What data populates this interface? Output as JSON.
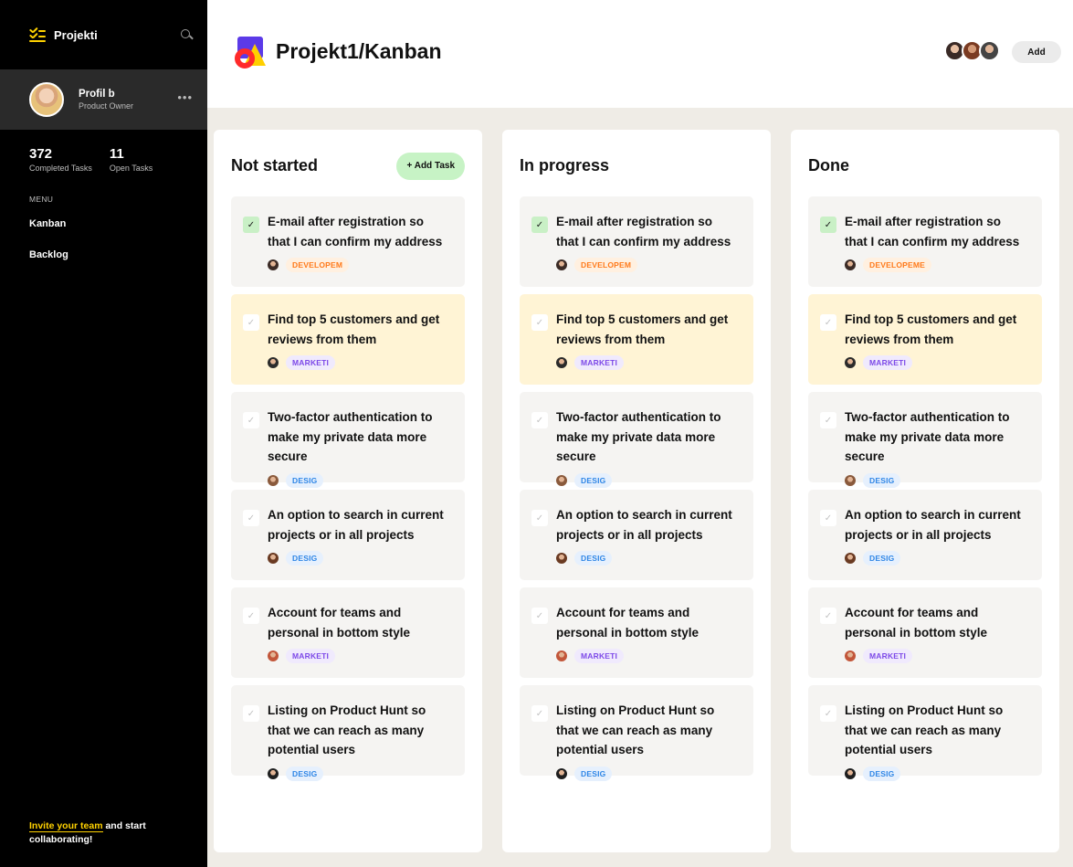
{
  "sidebar": {
    "brand": "Projekti",
    "profile": {
      "name": "Profil b",
      "role": "Product Owner"
    },
    "stats": [
      {
        "value": "372",
        "label": "Completed Tasks"
      },
      {
        "value": "11",
        "label": "Open Tasks"
      }
    ],
    "menu_title": "MENU",
    "menu": [
      {
        "label": "Kanban"
      },
      {
        "label": "Backlog"
      }
    ],
    "invite_link": "Invite your team",
    "invite_rest": " and start collaborating!"
  },
  "header": {
    "title": "Projekt1/Kanban",
    "add_label": "Add"
  },
  "add_task_label": "+ Add Task",
  "columns": [
    {
      "title": "Not started",
      "cards": [
        {
          "title": "E-mail after registration so that I can confirm my address",
          "tag": "DEVELOPEM",
          "tag_type": "dev",
          "checked": true,
          "highlight": false
        },
        {
          "title": "Find top 5 customers and get reviews from them",
          "tag": "MARKETI",
          "tag_type": "mkt",
          "checked": false,
          "highlight": true
        },
        {
          "title": "Two-factor authentication to make my private data more secure",
          "tag": "DESIG",
          "tag_type": "des",
          "checked": false,
          "highlight": false
        },
        {
          "title": "An option to search in current projects or in all projects",
          "tag": "DESIG",
          "tag_type": "des",
          "checked": false,
          "highlight": false
        },
        {
          "title": "Account for teams and personal in bottom style",
          "tag": "MARKETI",
          "tag_type": "mkt",
          "checked": false,
          "highlight": false
        },
        {
          "title": "Listing on Product Hunt so that we can reach as many potential users",
          "tag": "DESIG",
          "tag_type": "des",
          "checked": false,
          "highlight": false
        }
      ]
    },
    {
      "title": "In progress",
      "cards": [
        {
          "title": "E-mail after registration so that I can confirm my address",
          "tag": "DEVELOPEM",
          "tag_type": "dev",
          "checked": true,
          "highlight": false
        },
        {
          "title": "Find top 5 customers and get reviews from them",
          "tag": "MARKETI",
          "tag_type": "mkt",
          "checked": false,
          "highlight": true
        },
        {
          "title": "Two-factor authentication to make my private data more secure",
          "tag": "DESIG",
          "tag_type": "des",
          "checked": false,
          "highlight": false
        },
        {
          "title": "An option to search in current projects or in all projects",
          "tag": "DESIG",
          "tag_type": "des",
          "checked": false,
          "highlight": false
        },
        {
          "title": "Account for teams and personal in bottom style",
          "tag": "MARKETI",
          "tag_type": "mkt",
          "checked": false,
          "highlight": false
        },
        {
          "title": "Listing on Product Hunt so that we can reach as many potential users",
          "tag": "DESIG",
          "tag_type": "des",
          "checked": false,
          "highlight": false
        }
      ]
    },
    {
      "title": "Done",
      "cards": [
        {
          "title": "E-mail after registration so that I can confirm my address",
          "tag": "DEVELOPEME",
          "tag_type": "dev",
          "checked": true,
          "highlight": false
        },
        {
          "title": "Find top 5 customers and get reviews from them",
          "tag": "MARKETI",
          "tag_type": "mkt",
          "checked": false,
          "highlight": true
        },
        {
          "title": "Two-factor authentication to make my private data more secure",
          "tag": "DESIG",
          "tag_type": "des",
          "checked": false,
          "highlight": false
        },
        {
          "title": "An option to search in current projects or in all projects",
          "tag": "DESIG",
          "tag_type": "des",
          "checked": false,
          "highlight": false
        },
        {
          "title": "Account for teams and personal in bottom style",
          "tag": "MARKETI",
          "tag_type": "mkt",
          "checked": false,
          "highlight": false
        },
        {
          "title": "Listing on Product Hunt so that we can reach as many potential users",
          "tag": "DESIG",
          "tag_type": "des",
          "checked": false,
          "highlight": false
        }
      ]
    }
  ]
}
